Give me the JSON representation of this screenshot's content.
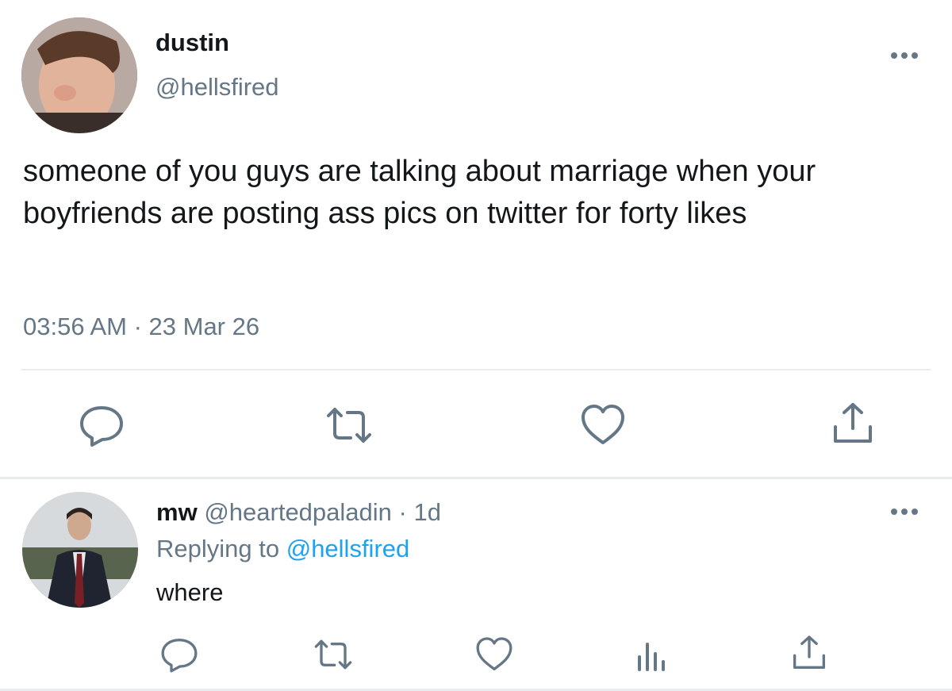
{
  "tweet": {
    "display_name": "dustin",
    "handle": "@hellsfired",
    "text": "someone of you guys are talking about marriage when your boyfriends are posting ass pics on twitter for forty likes",
    "timestamp": "03:56 AM · 23 Mar 26",
    "actions": [
      "reply-icon",
      "retweet-icon",
      "heart-icon",
      "share-icon"
    ]
  },
  "reply": {
    "display_name": "mw",
    "handle": "@heartedpaladin",
    "separator": " · ",
    "age": "1d",
    "replying_prefix": "Replying to ",
    "replying_mention": "@hellsfired",
    "text": "where",
    "actions": [
      "reply-icon",
      "retweet-icon",
      "heart-icon",
      "stats-icon",
      "share-icon"
    ]
  },
  "colors": {
    "primary_text": "#14171a",
    "secondary_text": "#657786",
    "link": "#1da1f2",
    "divider": "#e6ecf0"
  }
}
